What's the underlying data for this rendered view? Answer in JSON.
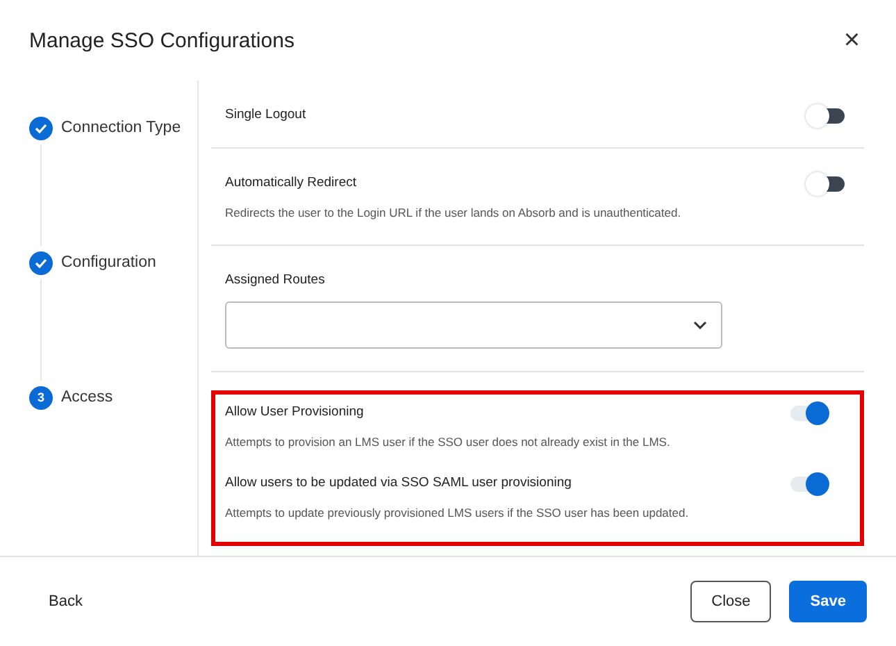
{
  "dialog": {
    "title": "Manage SSO Configurations",
    "close_icon": "×"
  },
  "steps": [
    {
      "label": "Connection Type",
      "completed": true
    },
    {
      "label": "Configuration",
      "completed": true
    },
    {
      "label": "Access",
      "completed": false,
      "number": "3"
    }
  ],
  "settings": [
    {
      "kind": "toggle",
      "label": "Single Logout",
      "on": false
    },
    {
      "kind": "toggle",
      "label": "Automatically Redirect",
      "description": "Redirects the user to the Login URL if the user lands on Absorb and is unauthenticated.",
      "on": false
    },
    {
      "kind": "select",
      "label": "Assigned Routes"
    }
  ],
  "highlighted_settings": [
    {
      "kind": "toggle",
      "label": "Allow User Provisioning",
      "description": "Attempts to provision an LMS user if the SSO user does not already exist in the LMS.",
      "on": true
    },
    {
      "kind": "toggle",
      "label": "Allow users to be updated via SSO SAML user provisioning",
      "description": "Attempts to update previously provisioned LMS users if the SSO user has been updated.",
      "on": true
    }
  ],
  "footer": {
    "back": "Back",
    "close": "Close",
    "save": "Save"
  }
}
